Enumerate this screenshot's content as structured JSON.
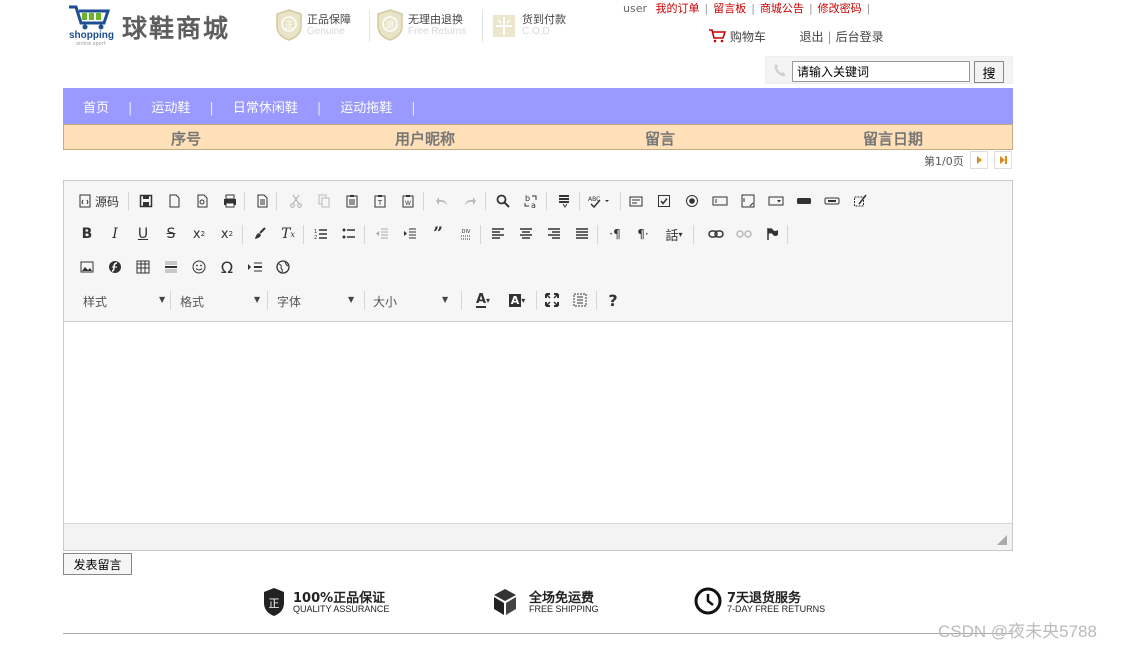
{
  "brand": {
    "word": "shopping",
    "sub": "online sport",
    "title": "球鞋商城"
  },
  "guarantees": [
    {
      "title": "正品保障",
      "sub": "Genuine",
      "icon": "shield-zheng-icon"
    },
    {
      "title": "无理由退换",
      "sub": "Free Returns",
      "icon": "shield-return-icon"
    },
    {
      "title": "货到付款",
      "sub": "C.O.D",
      "icon": "cod-icon"
    }
  ],
  "topnav": {
    "user": "user",
    "links": [
      "我的订单",
      "留言板",
      "商城公告",
      "修改密码"
    ]
  },
  "account": {
    "cart": "购物车",
    "logout": "退出",
    "admin": "后台登录"
  },
  "search": {
    "value": "请输入关键词",
    "button": "搜"
  },
  "nav": {
    "items": [
      "首页",
      "运动鞋",
      "日常休闲鞋",
      "运动拖鞋"
    ]
  },
  "table": {
    "headers": [
      "序号",
      "用户昵称",
      "留言",
      "留言日期"
    ]
  },
  "pager": {
    "info": "第1/0页"
  },
  "editor": {
    "source_label": "源码",
    "combos": [
      "样式",
      "格式",
      "字体",
      "大小"
    ]
  },
  "submit_label": "发表留言",
  "features": [
    {
      "title": "100%正品保证",
      "sub": "QUALITY ASSURANCE",
      "icon": "shield-quality-icon"
    },
    {
      "title": "全场免运费",
      "sub": "FREE SHIPPING",
      "icon": "box-icon"
    },
    {
      "title": "7天退货服务",
      "sub": "7-DAY FREE RETURNS",
      "icon": "clock-icon"
    }
  ],
  "watermark": "CSDN @夜未央5788",
  "colors": {
    "nav": "#9999ff",
    "table_header": "#ffe0b8",
    "link_red": "#cc0000",
    "logo_blue": "#1d4f91"
  }
}
